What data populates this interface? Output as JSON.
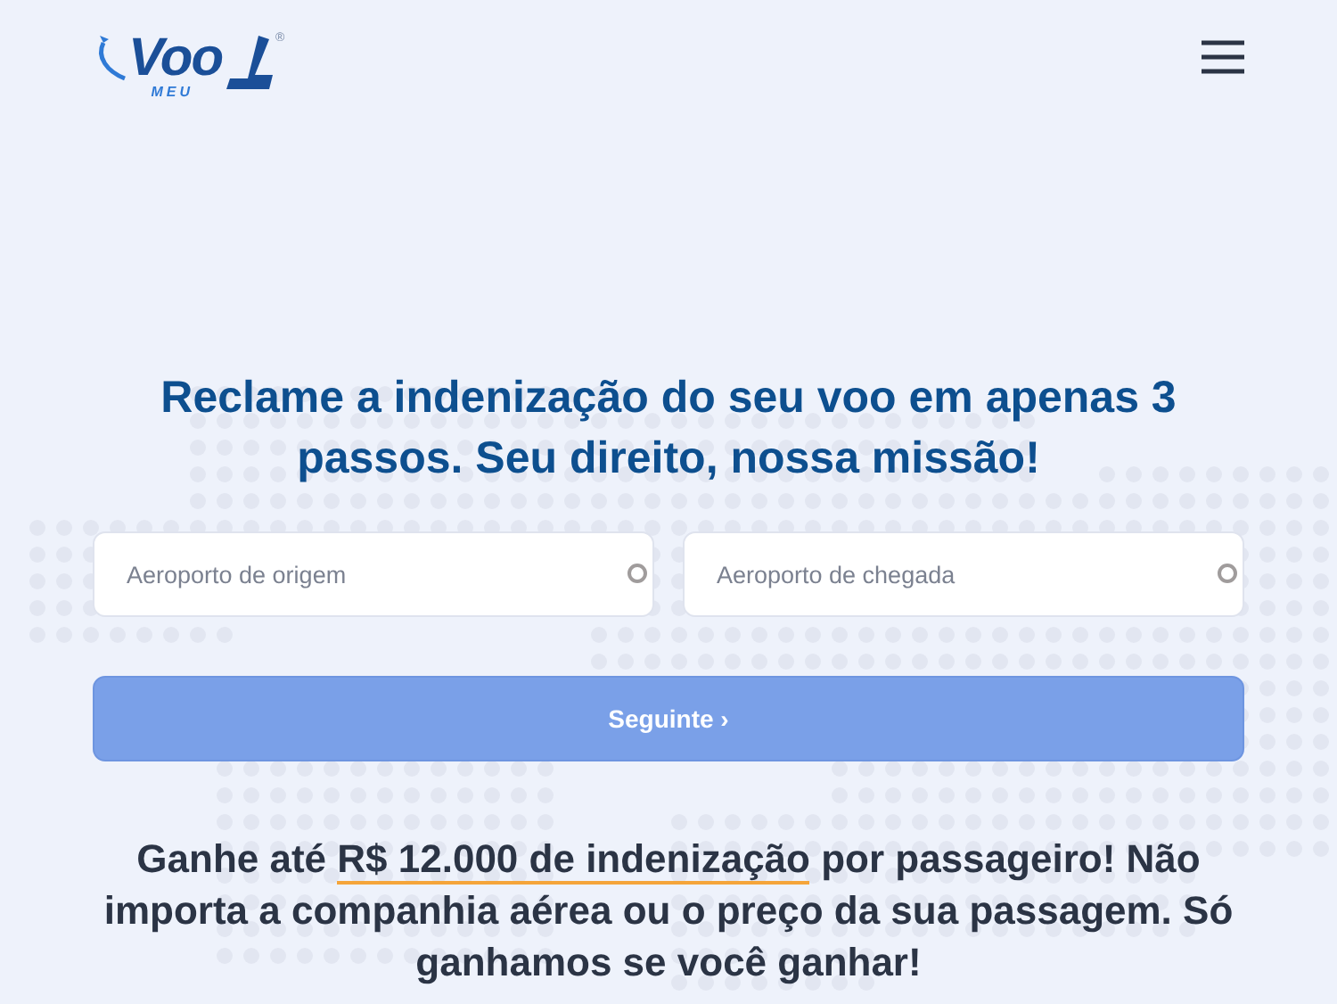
{
  "logo": {
    "word": "Voo",
    "sub": "MEU",
    "mark": "®"
  },
  "headline": "Reclame a indenização do seu voo em apenas 3 passos. Seu direito, nossa missão!",
  "fields": [
    {
      "placeholder": "Aeroporto de origem"
    },
    {
      "placeholder": "Aeroporto de chegada"
    }
  ],
  "submit": {
    "label": "Seguinte ›"
  },
  "pitch": {
    "before": "Ganhe até ",
    "highlight": "R$ 12.000 de indenização",
    "after": " por passageiro! Não importa a companhia aérea ou o preço da sua passagem. Só ganhamos se você ganhar!"
  }
}
